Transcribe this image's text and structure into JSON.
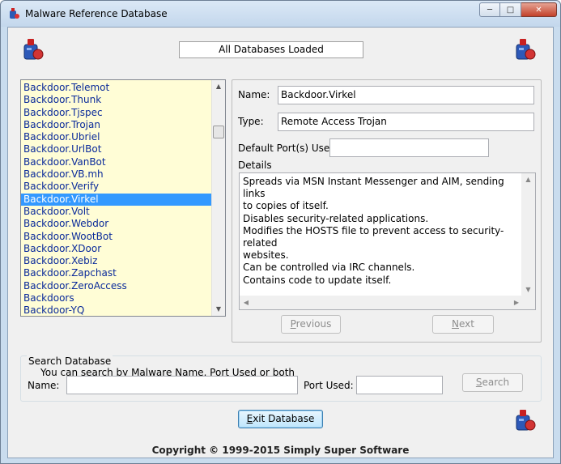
{
  "window": {
    "title": "Malware Reference Database",
    "min_glyph": "─",
    "max_glyph": "□",
    "close_glyph": "✕"
  },
  "header": {
    "status": "All Databases Loaded",
    "logo_icon": "virus-bottle-icon"
  },
  "malware_list": {
    "items": [
      "Backdoor.Telemot",
      "Backdoor.Thunk",
      "Backdoor.Tjspec",
      "Backdoor.Trojan",
      "Backdoor.Ubriel",
      "Backdoor.UrlBot",
      "Backdoor.VanBot",
      "Backdoor.VB.mh",
      "Backdoor.Verify",
      "Backdoor.Virkel",
      "Backdoor.Volt",
      "Backdoor.Webdor",
      "Backdoor.WootBot",
      "Backdoor.XDoor",
      "Backdoor.Xebiz",
      "Backdoor.Zapchast",
      "Backdoor.ZeroAccess",
      "Backdoors",
      "Backdoor-YQ"
    ],
    "selected_index": 9,
    "scroll_up_glyph": "▲",
    "scroll_down_glyph": "▼"
  },
  "details": {
    "name_label": "Name:",
    "name_value": "Backdoor.Virkel",
    "type_label": "Type:",
    "type_value": "Remote Access Trojan",
    "ports_label": "Default Port(s) Used:",
    "ports_value": "",
    "details_label": "Details",
    "details_text": "Spreads via MSN Instant Messenger and AIM, sending links\nto copies of itself.\nDisables security-related applications.\nModifies the HOSTS file to prevent access to security-related\nwebsites.\nCan be controlled via IRC channels.\nContains code to update itself.",
    "up_glyph": "▲",
    "down_glyph": "▼",
    "left_glyph": "◀",
    "right_glyph": "▶",
    "previous_label_underlined": "P",
    "previous_label_rest": "revious",
    "next_label_underlined": "N",
    "next_label_rest": "ext"
  },
  "search": {
    "group_title": "Search Database",
    "hint": "You can search by Malware Name, Port Used or both",
    "name_label": "Name:",
    "name_value": "",
    "port_label": "Port Used:",
    "port_value": "",
    "button_underlined": "S",
    "button_rest": "earch"
  },
  "exit_button_underlined": "E",
  "exit_button_rest": "xit Database",
  "footer": "Copyright © 1999-2015 Simply Super Software"
}
